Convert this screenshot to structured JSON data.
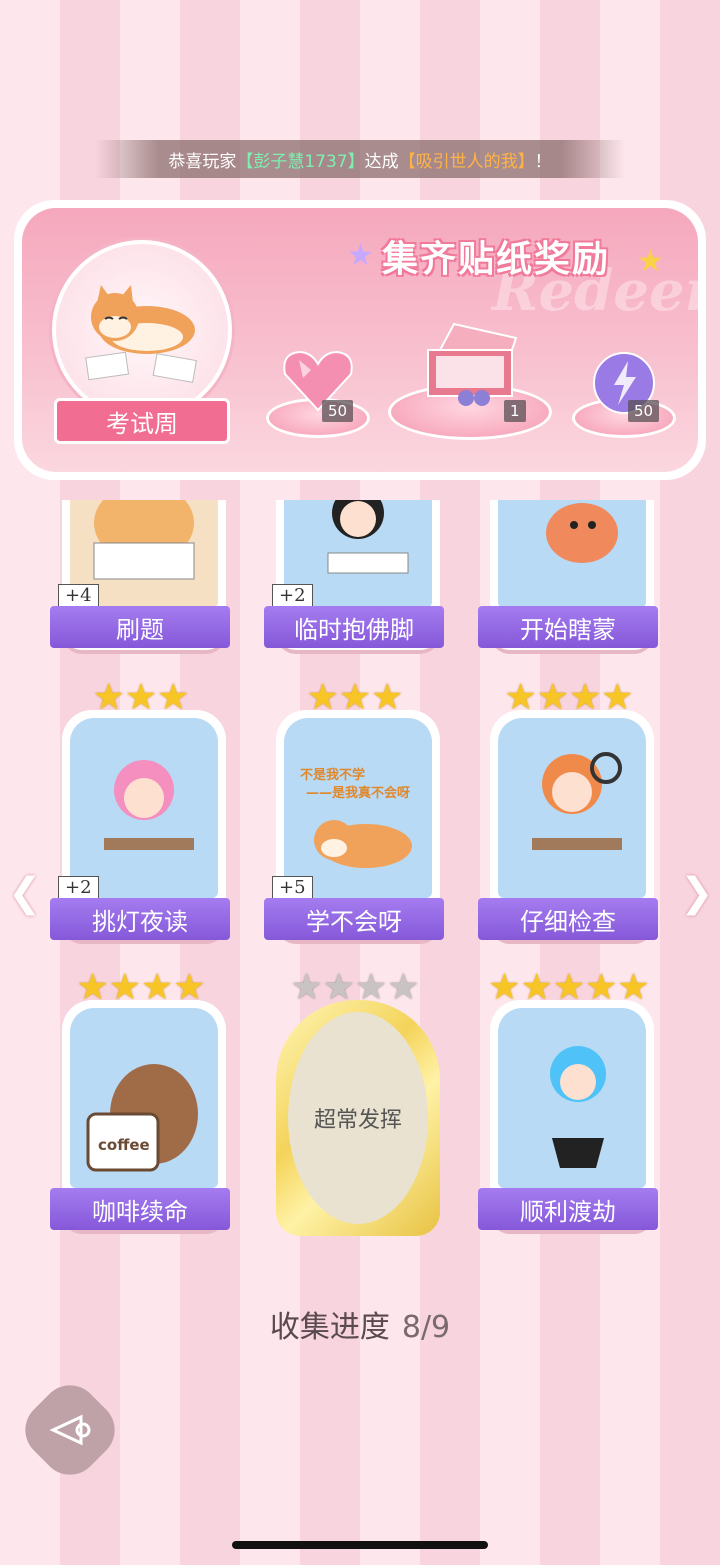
{
  "banner": {
    "prefix": "恭喜玩家",
    "player": "【彭子慧1737】",
    "middle": "达成",
    "achievement": "【吸引世人的我】",
    "suffix": "！"
  },
  "reward": {
    "title": "集齐贴纸奖励",
    "watermark": "Redeem",
    "theme_label": "考试周",
    "items": [
      {
        "icon": "pink-diamond-icon",
        "count": "50"
      },
      {
        "icon": "gift-box-icon",
        "count": "1"
      },
      {
        "icon": "purple-orb-icon",
        "count": "50"
      }
    ]
  },
  "cards": [
    {
      "name": "刷题",
      "plus": "+4",
      "stars": null
    },
    {
      "name": "临时抱佛脚",
      "plus": "+2",
      "stars": null
    },
    {
      "name": "开始瞎蒙",
      "plus": "",
      "stars": null
    },
    {
      "name": "挑灯夜读",
      "plus": "+2",
      "stars": 3
    },
    {
      "name": "学不会呀",
      "plus": "+5",
      "stars": 3,
      "art_text1": "不是我不学",
      "art_text2": "——是我真不会呀"
    },
    {
      "name": "仔细检查",
      "plus": "",
      "stars": 4
    },
    {
      "name": "咖啡续命",
      "plus": "",
      "stars": 4,
      "art_text1": "coffee"
    },
    {
      "name": "超常发挥",
      "plus": "",
      "stars": 4,
      "locked": true
    },
    {
      "name": "顺利渡劫",
      "plus": "",
      "stars": 5
    }
  ],
  "progress": {
    "label": "收集进度",
    "value": "8/9"
  },
  "colors": {
    "accent": "#f26d92",
    "card_label": "#8558d9",
    "star": "#f7c525"
  }
}
